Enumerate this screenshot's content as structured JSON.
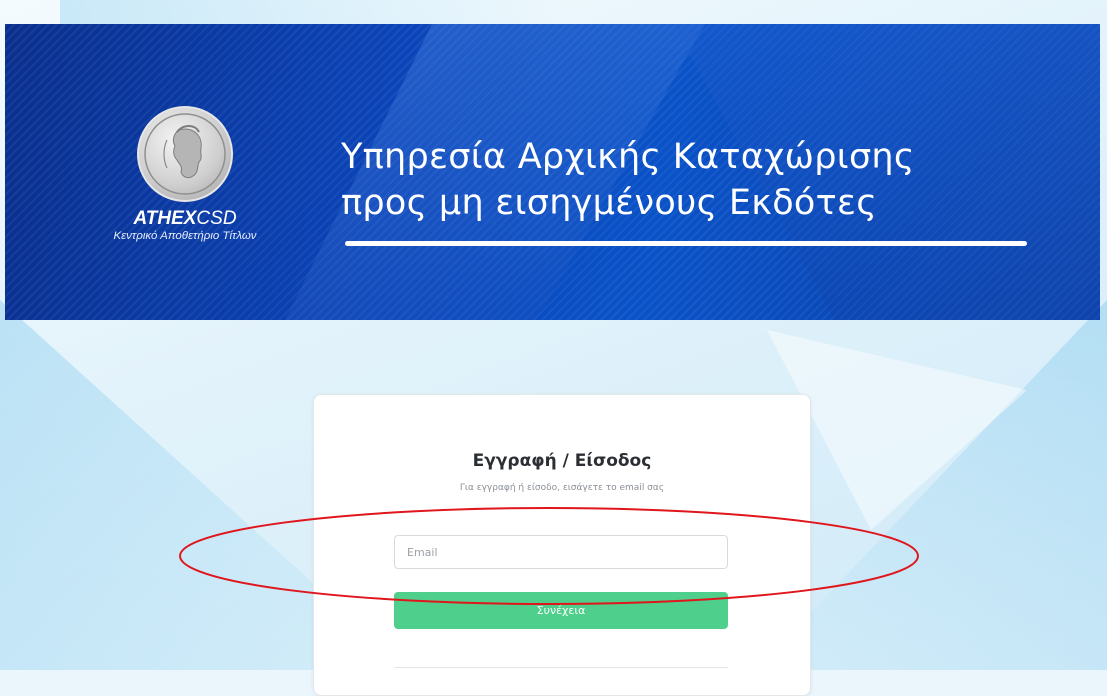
{
  "banner": {
    "headline_line1": "Υπηρεσία Αρχικής Καταχώρισης",
    "headline_line2": "προς μη εισηγμένους Εκδότες"
  },
  "logo": {
    "brand_bold": "ATHEX",
    "brand_light": "CSD",
    "tagline": "Κεντρικό Αποθετήριο Τίτλων",
    "icon": "hermes-coin-icon"
  },
  "card": {
    "title": "Εγγραφή / Είσοδος",
    "subtitle": "Για εγγραφή ή είσοδο, εισάγετε το email σας",
    "email": {
      "placeholder": "Email",
      "value": ""
    },
    "continue_label": "Συνέχεια"
  },
  "colors": {
    "banner_blue": "#0b44b8",
    "continue_green": "#4fcf8c",
    "highlight_red": "#e0161c"
  }
}
